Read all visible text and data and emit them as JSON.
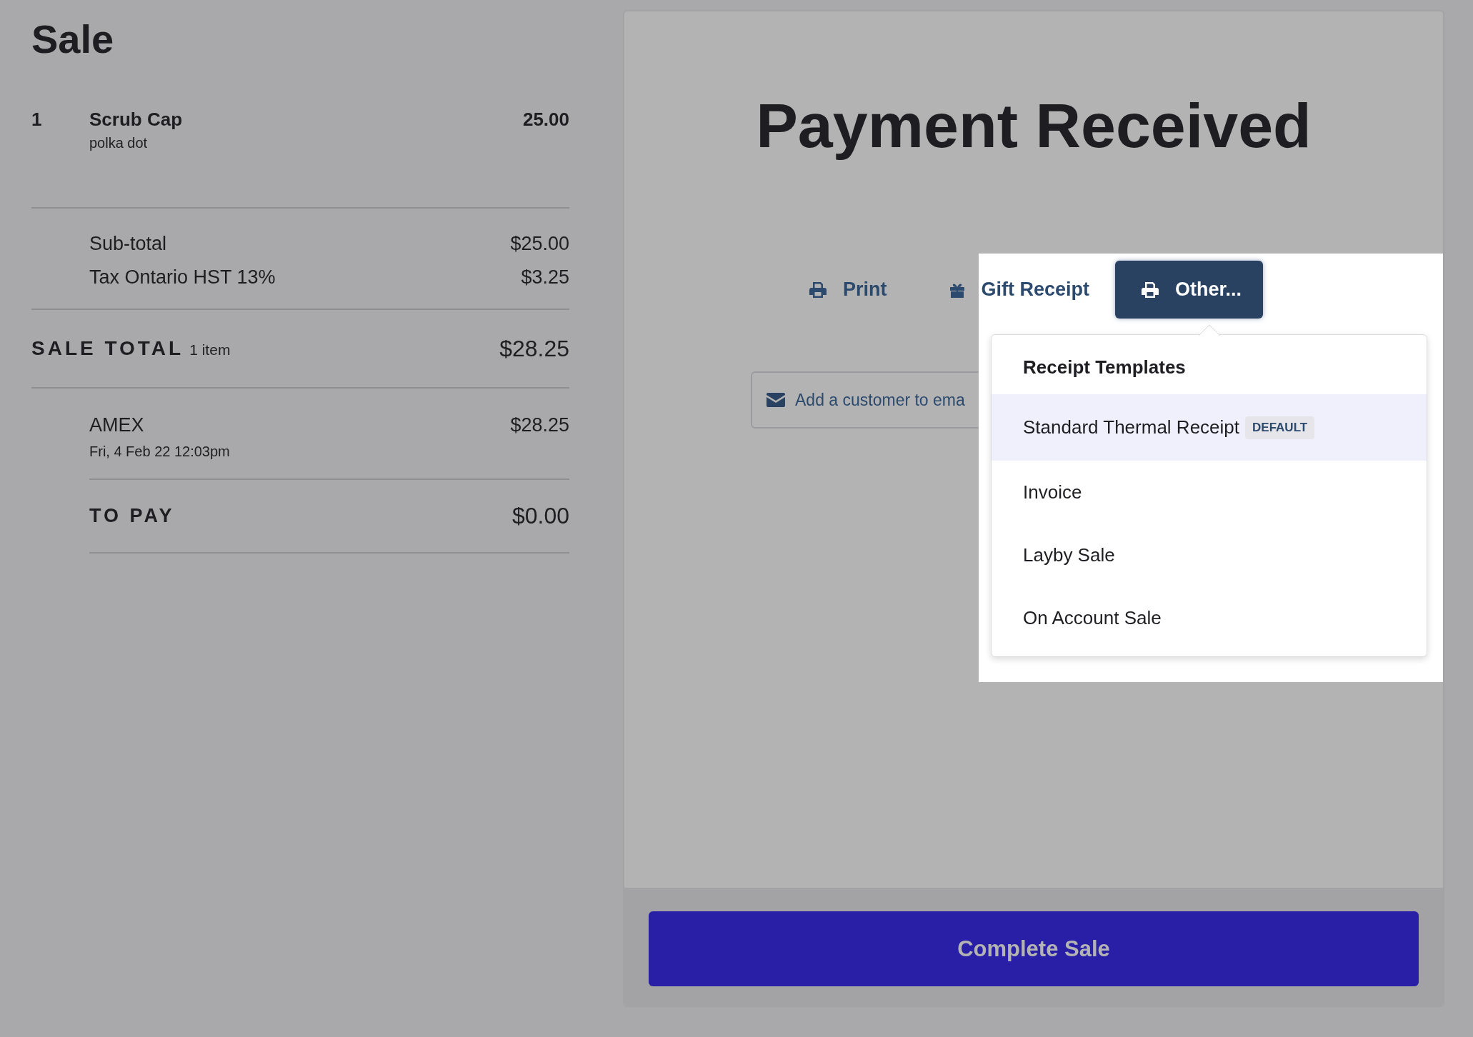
{
  "sale": {
    "title": "Sale",
    "items": [
      {
        "qty": "1",
        "name": "Scrub Cap",
        "variant": "polka dot",
        "price": "25.00"
      }
    ],
    "summary": [
      {
        "label": "Sub-total",
        "amount": "$25.00"
      },
      {
        "label": "Tax Ontario HST 13%",
        "amount": "$3.25"
      }
    ],
    "total": {
      "label": "SALE TOTAL",
      "count": "1 item",
      "amount": "$28.25"
    },
    "payments": [
      {
        "method": "AMEX",
        "date": "Fri, 4 Feb 22 12:03pm",
        "amount": "$28.25"
      }
    ],
    "to_pay": {
      "label": "TO PAY",
      "amount": "$0.00"
    }
  },
  "payment": {
    "title": "Payment Received",
    "actions": [
      {
        "kind": "print",
        "label": "Print",
        "selected": false
      },
      {
        "kind": "gift",
        "label": "Gift Receipt",
        "selected": false
      },
      {
        "kind": "other",
        "label": "Other...",
        "selected": true
      }
    ],
    "email_prompt": "Add a customer to ema",
    "menu": {
      "heading": "Receipt Templates",
      "items": [
        {
          "label": "Standard Thermal Receipt",
          "badge": "DEFAULT",
          "selected": true
        },
        {
          "label": "Invoice",
          "selected": false
        },
        {
          "label": "Layby Sale",
          "selected": false
        },
        {
          "label": "On Account Sale",
          "selected": false
        }
      ]
    },
    "complete_button": "Complete Sale"
  }
}
